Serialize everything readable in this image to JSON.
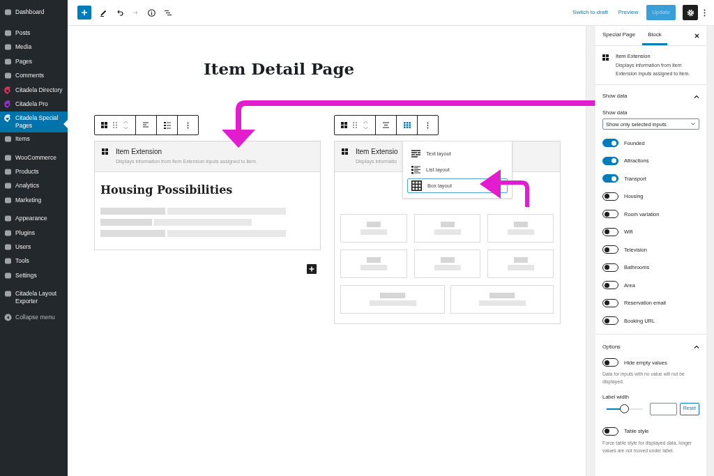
{
  "sidebar": {
    "groups": [
      [
        {
          "label": "Dashboard",
          "selected": false
        }
      ],
      [
        {
          "label": "Posts",
          "selected": false
        },
        {
          "label": "Media",
          "selected": false
        },
        {
          "label": "Pages",
          "selected": false
        },
        {
          "label": "Comments",
          "selected": false
        },
        {
          "label": "Citadela Directory",
          "selected": false,
          "color": "#e4325a"
        },
        {
          "label": "Citadela Pro",
          "selected": false,
          "color": "#9b35d0"
        },
        {
          "label": "Citadela Special Pages",
          "selected": true,
          "color": "#e8f4fb"
        },
        {
          "label": "Items",
          "selected": false
        }
      ],
      [
        {
          "label": "WooCommerce",
          "selected": false
        },
        {
          "label": "Products",
          "selected": false
        },
        {
          "label": "Analytics",
          "selected": false
        },
        {
          "label": "Marketing",
          "selected": false
        }
      ],
      [
        {
          "label": "Appearance",
          "selected": false
        },
        {
          "label": "Plugins",
          "selected": false
        },
        {
          "label": "Users",
          "selected": false
        },
        {
          "label": "Tools",
          "selected": false
        },
        {
          "label": "Settings",
          "selected": false
        }
      ],
      [
        {
          "label": "Citadela Layout Exporter",
          "selected": false
        }
      ]
    ],
    "collapse": "Collapse menu"
  },
  "top_bar": {
    "switch_to_draft": "Switch to draft",
    "preview": "Preview",
    "update": "Update",
    "update_disabled": true,
    "settings_open": true
  },
  "editor": {
    "title": "Item Detail Page",
    "blocks": [
      {
        "kind": "list",
        "name": "Item Extension",
        "description": "Displays information from Item Extension inputs assigned to item.",
        "heading": "Housing Possibilities"
      },
      {
        "kind": "box",
        "name": "Item Extensio",
        "description": "Displays informatio",
        "layout_menu": [
          {
            "label": "Text layout",
            "kind": "text",
            "selected": false
          },
          {
            "label": "List layout",
            "kind": "list",
            "selected": false
          },
          {
            "label": "Box layout",
            "kind": "box",
            "selected": true
          }
        ]
      }
    ]
  },
  "settings_panel": {
    "tabs": [
      {
        "label": "Special Page",
        "selected": false
      },
      {
        "label": "Block",
        "selected": true
      }
    ],
    "block_card": {
      "name": "Item Extension",
      "description": "Displays information from Item Extension inputs assigned to item."
    },
    "show_data": {
      "title": "Show data",
      "expanded": true,
      "select_label": "Show data",
      "select_value": "Show only selected inputs",
      "toggles": [
        {
          "label": "Founded",
          "on": true
        },
        {
          "label": "Attractions",
          "on": true
        },
        {
          "label": "Transport",
          "on": true
        },
        {
          "label": "Housing",
          "on": false
        },
        {
          "label": "Room variation",
          "on": false
        },
        {
          "label": "Wifi",
          "on": false
        },
        {
          "label": "Television",
          "on": false
        },
        {
          "label": "Bathrooms",
          "on": false
        },
        {
          "label": "Area",
          "on": false
        },
        {
          "label": "Reservation email",
          "on": false
        },
        {
          "label": "Booking URL",
          "on": false
        }
      ]
    },
    "options": {
      "title": "Options",
      "expanded": true,
      "hide_empty": {
        "label": "Hide empty values",
        "on": false
      },
      "hide_empty_help": "Data for inputs with no value will not be displayed.",
      "label_width": {
        "label": "Label width",
        "level": 0.5,
        "reset": "Reset"
      },
      "table_style": {
        "label": "Table style",
        "on": false
      },
      "table_style_help": "Force table style for displayed data, longer values are not moved under label."
    }
  }
}
